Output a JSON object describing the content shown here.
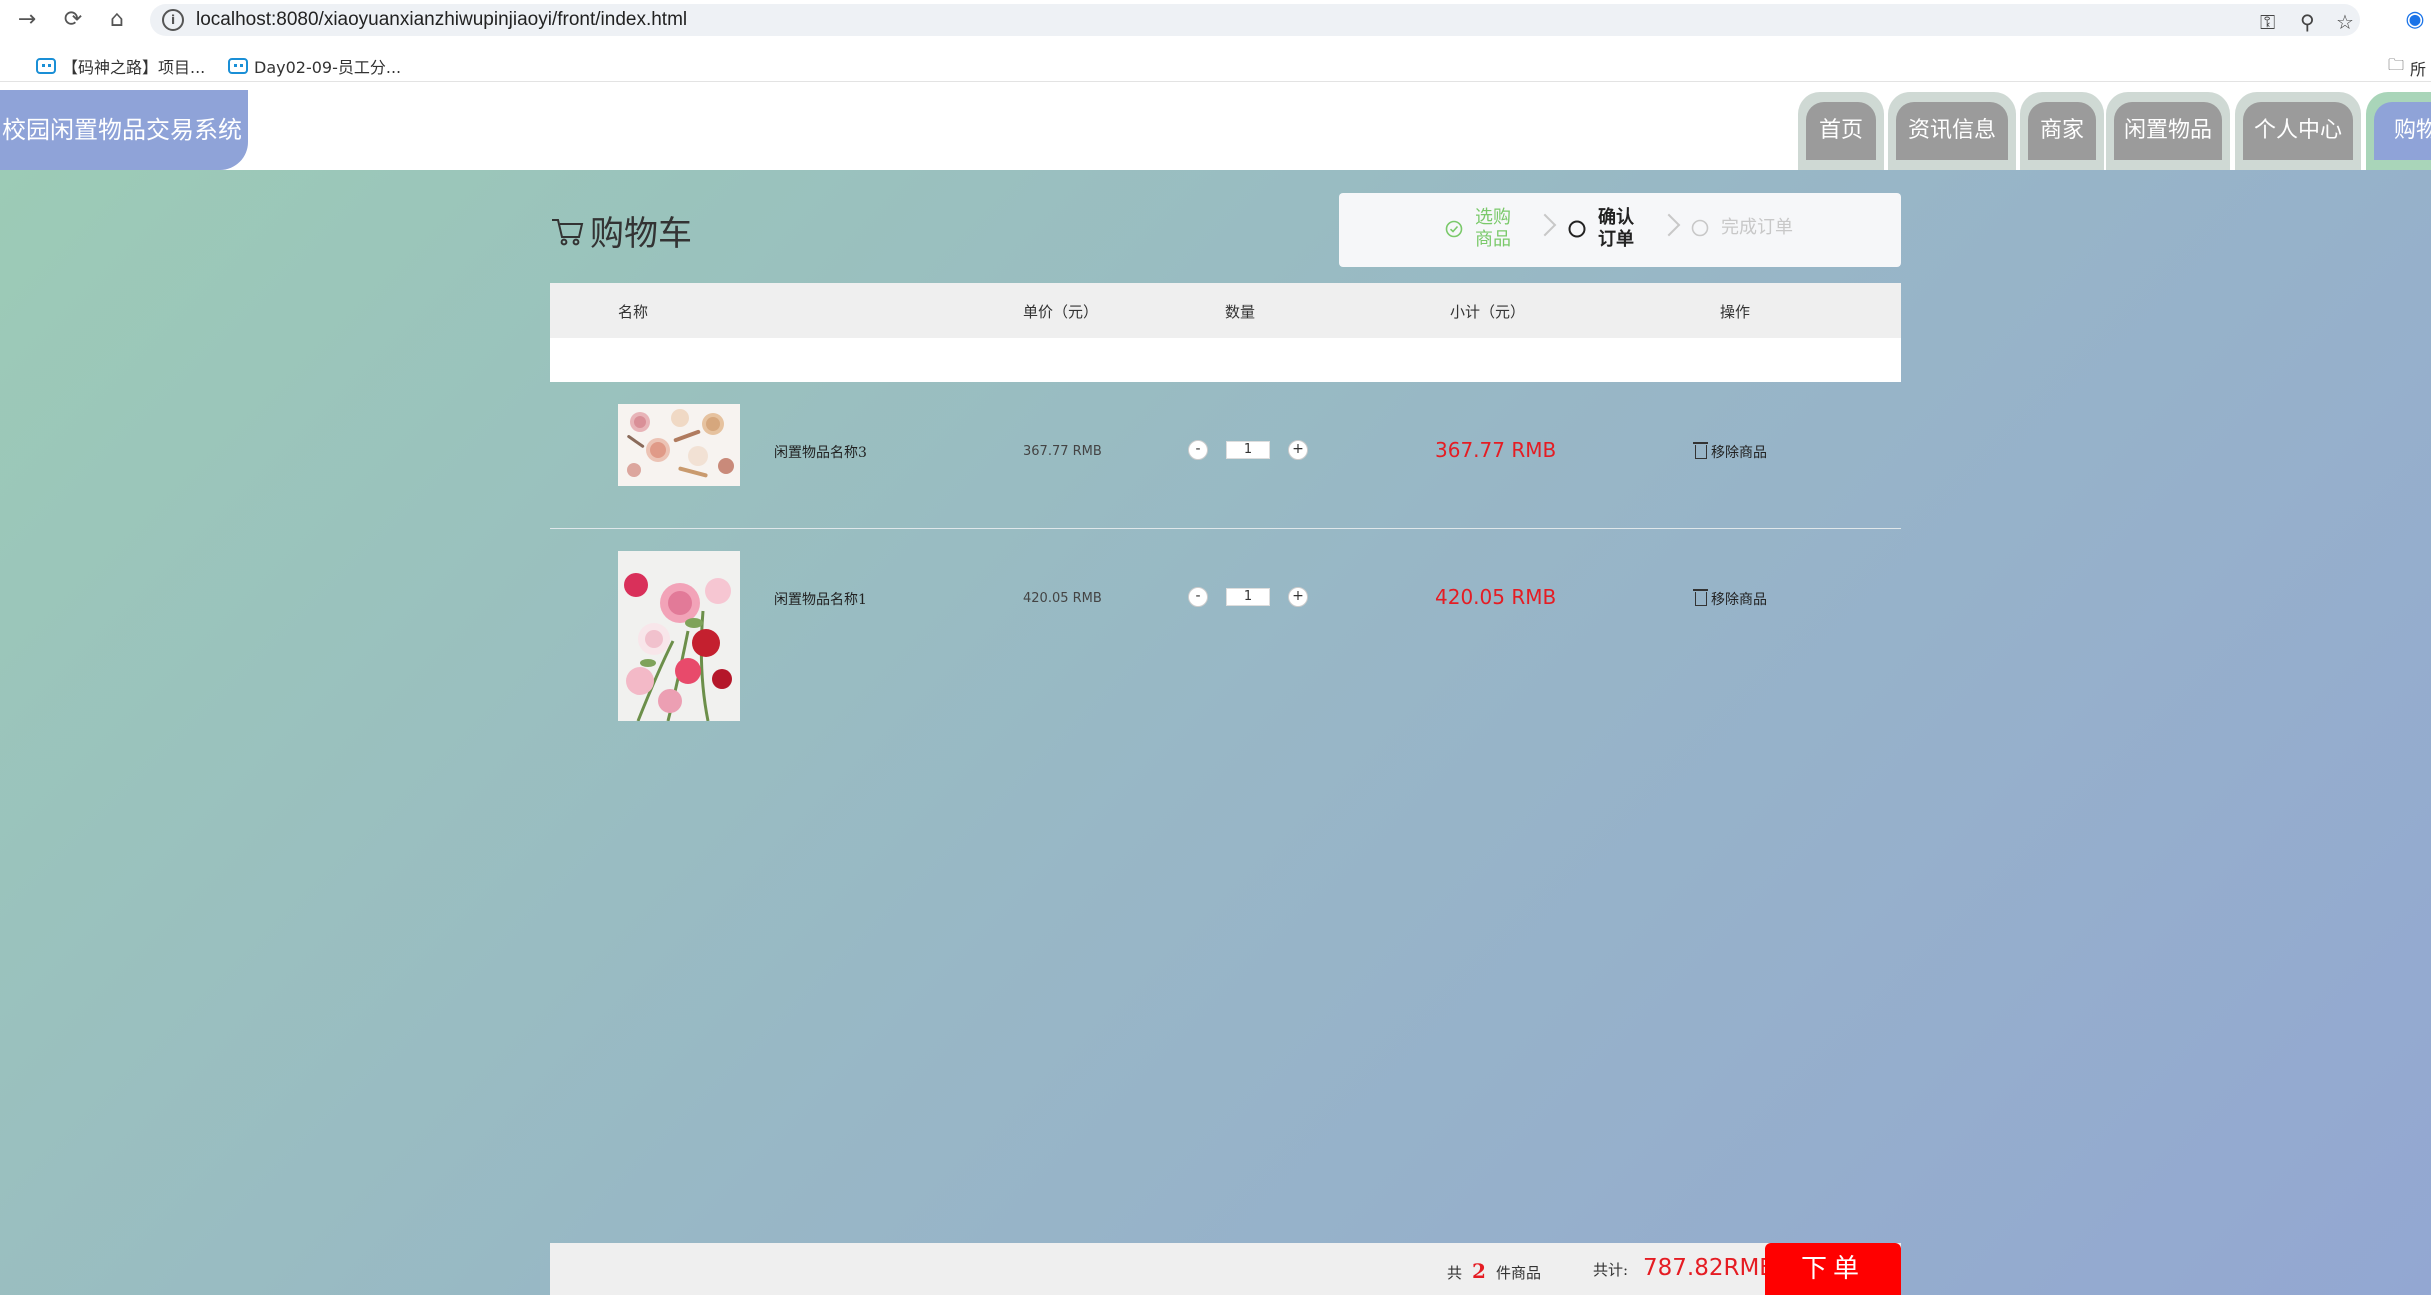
{
  "browser": {
    "url": "localhost:8080/xiaoyuanxianzhiwupinjiaoyi/front/index.html",
    "bookmarks": [
      "【码神之路】项目...",
      "Day02-09-员工分..."
    ],
    "bookmark_folder": "所"
  },
  "app": {
    "title": "校园闲置物品交易系统",
    "nav": [
      "首页",
      "资讯信息",
      "商家",
      "闲置物品",
      "个人中心",
      "购物"
    ],
    "active_nav": "购物"
  },
  "cart": {
    "title": "购物车",
    "steps": [
      {
        "label": "选购商品",
        "state": "done",
        "color": "#7ac96a"
      },
      {
        "label": "确认订单",
        "state": "current",
        "color": "#222222"
      },
      {
        "label": "完成订单",
        "state": "pending",
        "color": "#c8c8c8"
      }
    ],
    "columns": [
      "名称",
      "单价（元）",
      "数量",
      "小计（元）",
      "操作"
    ],
    "items": [
      {
        "name": "闲置物品名称3",
        "unit_price": "367.77 RMB",
        "quantity": "1",
        "subtotal": "367.77 RMB",
        "action": "移除商品",
        "image": "cosmetics-photo"
      },
      {
        "name": "闲置物品名称1",
        "unit_price": "420.05 RMB",
        "quantity": "1",
        "subtotal": "420.05 RMB",
        "action": "移除商品",
        "image": "flowers-photo"
      }
    ],
    "footer": {
      "count_prefix": "共",
      "count": "2",
      "count_suffix": "件商品",
      "total_label": "共计:",
      "total": "787.82RMB",
      "order_button": "下单"
    }
  },
  "colors": {
    "price_red": "#e51c23",
    "order_button": "#ff0000",
    "nav_active": "#8fa3d8",
    "nav_inactive": "#9b9b9b"
  }
}
